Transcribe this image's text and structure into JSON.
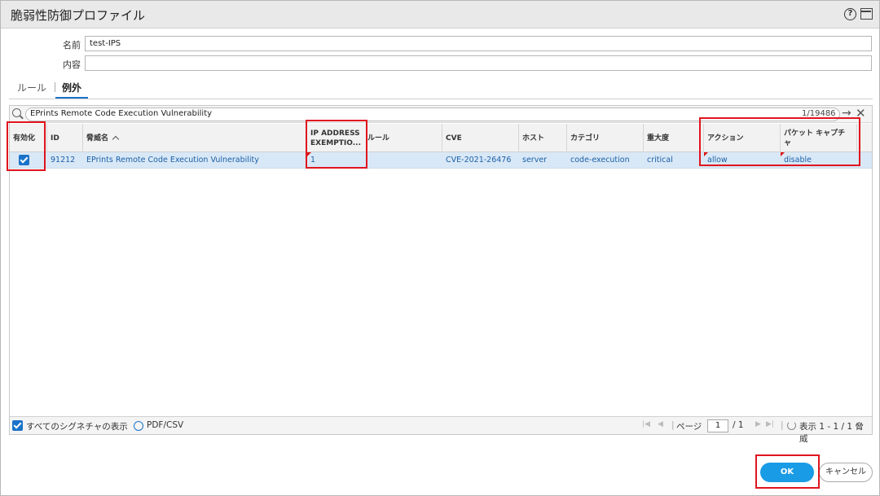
{
  "dialog": {
    "title": "脆弱性防御プロファイル"
  },
  "form": {
    "name_label": "名前",
    "name_value": "test-IPS",
    "description_label": "内容",
    "description_value": ""
  },
  "tabs": [
    {
      "label": "ルール",
      "active": false
    },
    {
      "label": "例外",
      "active": true
    }
  ],
  "search": {
    "query": "EPrints Remote Code Execution Vulnerability",
    "count": "1/19486"
  },
  "table": {
    "headers": {
      "enable": "有効化",
      "id": "ID",
      "threat_name": "脅威名",
      "ip_exempt_line1": "IP ADDRESS",
      "ip_exempt_line2": "EXEMPTIO...",
      "rule": "ルール",
      "cve": "CVE",
      "host": "ホスト",
      "category": "カテゴリ",
      "severity": "重大度",
      "action": "アクション",
      "packet_capture_line1": "パケット キャプチ",
      "packet_capture_line2": "ャ"
    },
    "rows": [
      {
        "enabled": true,
        "id": "91212",
        "threat_name": "EPrints Remote Code Execution Vulnerability",
        "ip_exempt": "1",
        "rule": "",
        "cve": "CVE-2021-26476",
        "host": "server",
        "category": "code-execution",
        "severity": "critical",
        "action": "allow",
        "packet_capture": "disable"
      }
    ]
  },
  "footer": {
    "show_all_label": "すべてのシグネチャの表示",
    "pdf_csv_label": "PDF/CSV",
    "page_label": "ページ",
    "page_value": "1",
    "page_total": "/ 1",
    "display_summary": "表示 1 - 1 / 1 脅威"
  },
  "buttons": {
    "ok": "OK",
    "cancel": "キャンセル"
  },
  "colors": {
    "accent": "#1a73c9",
    "ok_button": "#1a9be6",
    "highlight": "#e0141e",
    "selected_row": "#d9e8f6"
  }
}
